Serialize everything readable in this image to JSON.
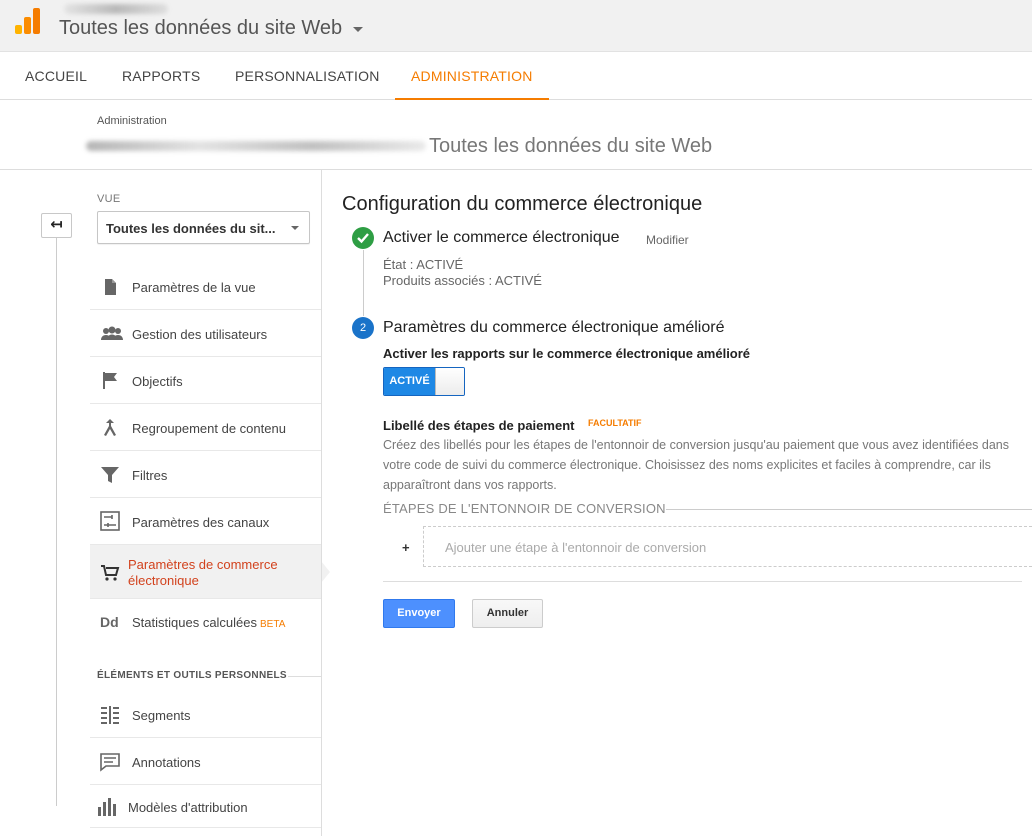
{
  "header": {
    "property_title": "Toutes les données du site Web"
  },
  "nav": {
    "items": [
      {
        "label": "ACCUEIL"
      },
      {
        "label": "RAPPORTS"
      },
      {
        "label": "PERSONNALISATION"
      },
      {
        "label": "ADMINISTRATION"
      }
    ],
    "active": "ADMINISTRATION"
  },
  "admin_header": {
    "label": "Administration",
    "property": "Toutes les données du site Web"
  },
  "sidebar": {
    "vue_label": "VUE",
    "vue_selected": "Toutes les données du sit...",
    "items": [
      {
        "label": "Paramètres de la vue",
        "icon": "document-icon"
      },
      {
        "label": "Gestion des utilisateurs",
        "icon": "users-icon"
      },
      {
        "label": "Objectifs",
        "icon": "flag-icon"
      },
      {
        "label": "Regroupement de contenu",
        "icon": "content-grouping-icon"
      },
      {
        "label": "Filtres",
        "icon": "filter-icon"
      },
      {
        "label": "Paramètres des canaux",
        "icon": "channel-settings-icon"
      },
      {
        "label_line1": "Paramètres de commerce",
        "label_line2": "électronique",
        "icon": "cart-icon"
      },
      {
        "label": "Statistiques calculées",
        "badge": "BETA",
        "icon": "dd-icon"
      }
    ],
    "section_label": "ÉLÉMENTS ET OUTILS PERSONNELS",
    "personal_items": [
      {
        "label": "Segments",
        "icon": "segments-icon"
      },
      {
        "label": "Annotations",
        "icon": "annotation-icon"
      },
      {
        "label": "Modèles d'attribution",
        "icon": "attribution-icon"
      }
    ]
  },
  "main": {
    "title": "Configuration du commerce électronique",
    "step1": {
      "title": "Activer le commerce électronique",
      "modify_link": "Modifier",
      "etat": "État : ACTIVÉ",
      "produits": "Produits associés : ACTIVÉ"
    },
    "step2": {
      "number": "2",
      "title": "Paramètres du commerce électronique amélioré",
      "enhanced_label": "Activer les rapports sur le commerce électronique amélioré",
      "toggle_label": "ACTIVÉ",
      "libelle_title": "Libellé des étapes de paiement",
      "facultatif": "FACULTATIF",
      "description": "Créez des libellés pour les étapes de l'entonnoir de conversion jusqu'au paiement que vous avez identifiées dans votre code de suivi du commerce électronique. Choisissez des noms explicites et faciles à comprendre, car ils apparaîtront dans vos rapports.",
      "etapes_label": "ÉTAPES DE L'ENTONNOIR DE CONVERSION",
      "plus": "+",
      "add_step_placeholder": "Ajouter une étape à l'entonnoir de conversion"
    },
    "buttons": {
      "send": "Envoyer",
      "cancel": "Annuler"
    }
  },
  "colors": {
    "accent": "#f57c00",
    "active_menu_text": "#d2421d",
    "success": "#2e9e44",
    "step_blue": "#1a73c9",
    "toggle_blue": "#1e88e5",
    "primary_button": "#4d90fe"
  }
}
